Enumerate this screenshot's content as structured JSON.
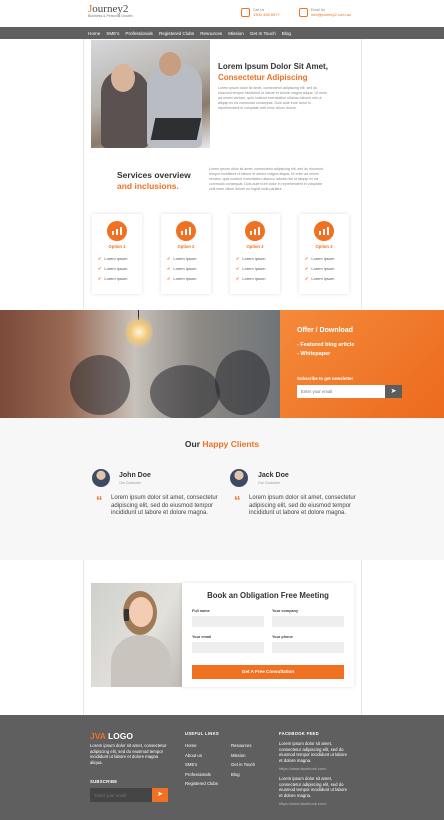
{
  "header": {
    "logo_text": "ourney2",
    "logo_letter": "J",
    "logo_subtitle": "Business & Personal Growth",
    "call_label": "Call Us",
    "call_value": "1300 438 6977",
    "email_label": "Email Us",
    "email_value": "info@journey2.com.au"
  },
  "nav": [
    "Home",
    "SME's",
    "Professionals",
    "Registered Clubs",
    "Resources",
    "Mission",
    "Get In Touch",
    "Blog"
  ],
  "hero": {
    "title_line1": "Lorem Ipsum Dolor Sit Amet,",
    "title_line2": "Consectetur Adipiscing",
    "body": "Lorem ipsum dolor sit amet, consectetur adipiscing elit, sed do eiusmod tempor incididunt ut labore et dolore magna aliqua. Ut enim ad minim veniam, quis nostrud exercitation ullamco laboris nisi ut aliquip ex ea commodo consequat. Duis aute irure dolor in reprehenderit in voluptate velit esse cillum dolore."
  },
  "services": {
    "title_line1": "Services overview",
    "title_line2": "and inclusions.",
    "body": "Lorem ipsum dolor sit amet, consectetur adipiscing elit, sed do eiusmod tempor incididunt ut labore et dolore magna aliqua. Ut enim ad minim veniam, quis nostrud exercitation ullamco laboris nisi ut aliquip ex ea commodo consequat. Duis aute irure dolor in reprehenderit in voluptate velit esse cillum dolore eu fugiat nulla pariatur.",
    "cards": [
      {
        "title": "Option 1",
        "items": [
          "Lorem ipsum",
          "Lorem ipsum",
          "Lorem ipsum"
        ]
      },
      {
        "title": "Option 2",
        "items": [
          "Lorem ipsum",
          "Lorem ipsum",
          "Lorem ipsum"
        ]
      },
      {
        "title": "Option 3",
        "items": [
          "Lorem ipsum",
          "Lorem ipsum",
          "Lorem ipsum"
        ]
      },
      {
        "title": "Option 3",
        "items": [
          "Lorem ipsum",
          "Lorem ipsum",
          "Lorem ipsum"
        ]
      }
    ]
  },
  "offer": {
    "title": "Offer / Download",
    "item1": "- Featured blog article",
    "item2": "- Whitepaper",
    "subscribe_label": "Subscribe to get newsletter",
    "email_placeholder": "Enter your email"
  },
  "clients": {
    "title_a": "Our",
    "title_b": "Happy Clients",
    "quote_mark": "“",
    "items": [
      {
        "name": "John Doe",
        "role": "Our Customer",
        "text": "Lorem ipsum dolor sit amet, consectetur adipiscing elit, sed do eiusmod tempor incididunt ut labore et dolore magna."
      },
      {
        "name": "Jack Doe",
        "role": "Our Customer",
        "text": "Lorem ipsum dolor sit amet, consectetur adipiscing elit, sed do eiusmod tempor incididunt ut labore et dolore magna."
      }
    ]
  },
  "meeting": {
    "title": "Book an Obligation Free Meeting",
    "full_name": "Full name",
    "company": "Your company",
    "email": "Your email",
    "phone": "Your phone",
    "cta": "Get A Free Consultation"
  },
  "footer": {
    "logo_a": "JVA",
    "logo_b": "LOGO",
    "about": "Lorem ipsum dolor sit amet, consectetur adipiscing elit, sed do eiusmod tempor incididunt ut labore et dolore magna aliqua.",
    "subscribe": "SUBSCRIBE",
    "email_placeholder": "Enter your email",
    "useful_links_title": "USEFUL LINKS",
    "links_col1": [
      "Home",
      "About us",
      "SME's",
      "Professionals",
      "Registered Clubs"
    ],
    "links_col2": [
      "Resources",
      "Mission",
      "Get in Touch",
      "Blog"
    ],
    "feed_title": "FACEBOOK FEED",
    "feed1": "Lorem ipsum dolor sit amet, consectetur adipiscing elit, sed do eiusmod tempor incididunt ut labore et dolore magna.",
    "feed1_url": "https://www.facebook.com/",
    "feed2": "Lorem ipsum dolor sit amet, consectetur adipiscing elit, sed do eiusmod tempor incididunt ut labore et dolore magna.",
    "feed2_url": "https://www.facebook.com/"
  },
  "colors": {
    "accent": "#f07122",
    "nav_bg": "#5f5f5f",
    "footer_bg": "#5f5f5f"
  },
  "icons": {
    "phone": "phone-icon",
    "mail": "mail-icon",
    "check": "check-icon",
    "send": "send-icon",
    "chart": "chart-icon"
  }
}
